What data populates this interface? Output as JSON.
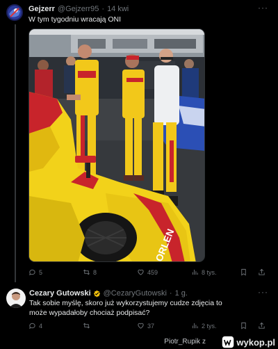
{
  "tweet1": {
    "display_name": "Gejzerr",
    "handle": "@Gejzerr95",
    "separator": "·",
    "time": "14 kwi",
    "text": "W tym tygodniu wracają ONI",
    "media_icon": "racing-photo",
    "stats": {
      "replies": "5",
      "retweets": "8",
      "likes": "459",
      "views": "8 tys."
    }
  },
  "tweet2": {
    "display_name": "Cezary Gutowski",
    "handle": "@CezaryGutowski",
    "separator": "·",
    "time": "1 g.",
    "text": "Tak sobie myślę, skoro już wykorzystujemy cudze zdjęcia to może wypadałoby chociaż podpisać?",
    "stats": {
      "replies": "4",
      "retweets": "",
      "likes": "37",
      "views": "2 tys."
    }
  },
  "footer": {
    "username": "Piotr_Rupik",
    "z": "z",
    "site": "wykop.pl"
  },
  "colors": {
    "bg": "#000000",
    "text": "#e7e9ea",
    "muted": "#71767b",
    "verified": "#f4c20d",
    "car_yellow": "#f2d21a",
    "car_red": "#c8242b"
  }
}
